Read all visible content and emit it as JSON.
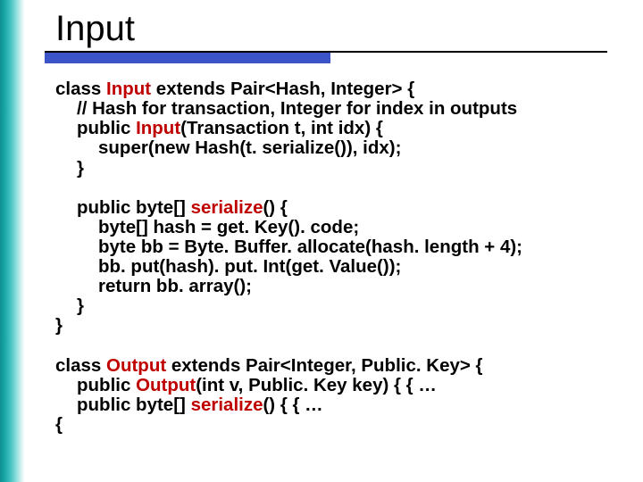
{
  "title": "Input",
  "code": {
    "l01a": "class ",
    "l01b": "Input",
    "l01c": " extends Pair<Hash, Integer> {",
    "l02": "// Hash for transaction, Integer for index in outputs",
    "l03a": "public ",
    "l03b": "Input",
    "l03c": "(Transaction t, int idx) {",
    "l04": "super(new Hash(t. serialize()), idx);",
    "l05": "}",
    "l06a": "public byte[] ",
    "l06b": "serialize",
    "l06c": "() {",
    "l07": "byte[] hash = get. Key(). code;",
    "l08": "byte bb = Byte. Buffer. allocate(hash. length + 4);",
    "l09": "bb. put(hash). put. Int(get. Value());",
    "l10": "return bb. array();",
    "l11": "}",
    "l12": "}",
    "l13a": "class ",
    "l13b": "Output",
    "l13c": " extends Pair<Integer, Public. Key> {",
    "l14a": "public ",
    "l14b": "Output",
    "l14c": "(int v, Public. Key key) { { …",
    "l15a": "public byte[] ",
    "l15b": "serialize",
    "l15c": "() { { …",
    "l16": "{"
  }
}
